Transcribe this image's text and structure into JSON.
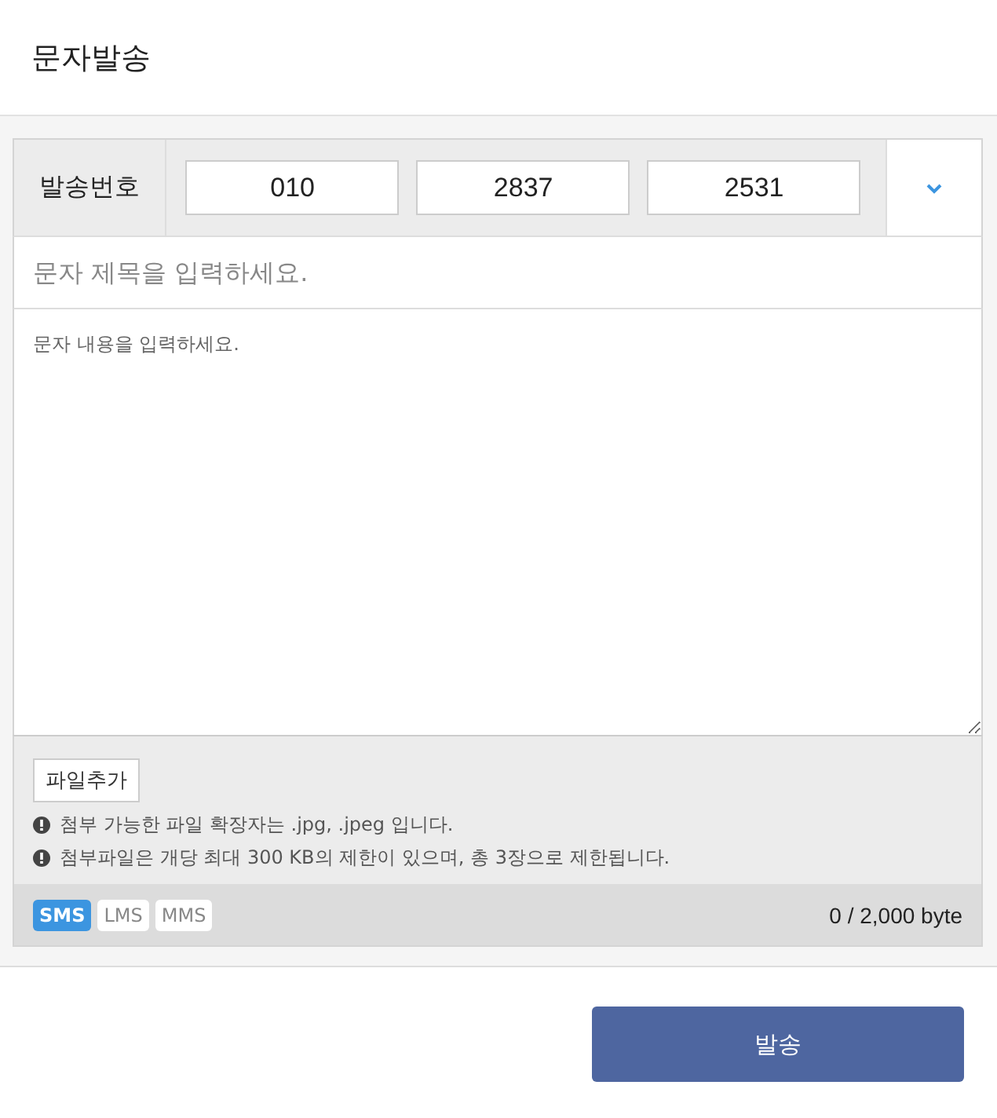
{
  "title": "문자발송",
  "sender": {
    "label": "발송번호",
    "parts": [
      "010",
      "2837",
      "2531"
    ]
  },
  "subject": {
    "placeholder": "문자 제목을 입력하세요."
  },
  "body": {
    "placeholder": "문자 내용을 입력하세요."
  },
  "attach": {
    "button": "파일추가",
    "notes": [
      "첨부 가능한 파일 확장자는 .jpg, .jpeg 입니다.",
      "첨부파일은 개당 최대 300 KB의 제한이 있으며, 총 3장으로 제한됩니다."
    ]
  },
  "types": [
    {
      "label": "SMS",
      "selected": true
    },
    {
      "label": "LMS",
      "selected": false
    },
    {
      "label": "MMS",
      "selected": false
    }
  ],
  "counter": "0 / 2,000 byte",
  "send_button": "발송"
}
